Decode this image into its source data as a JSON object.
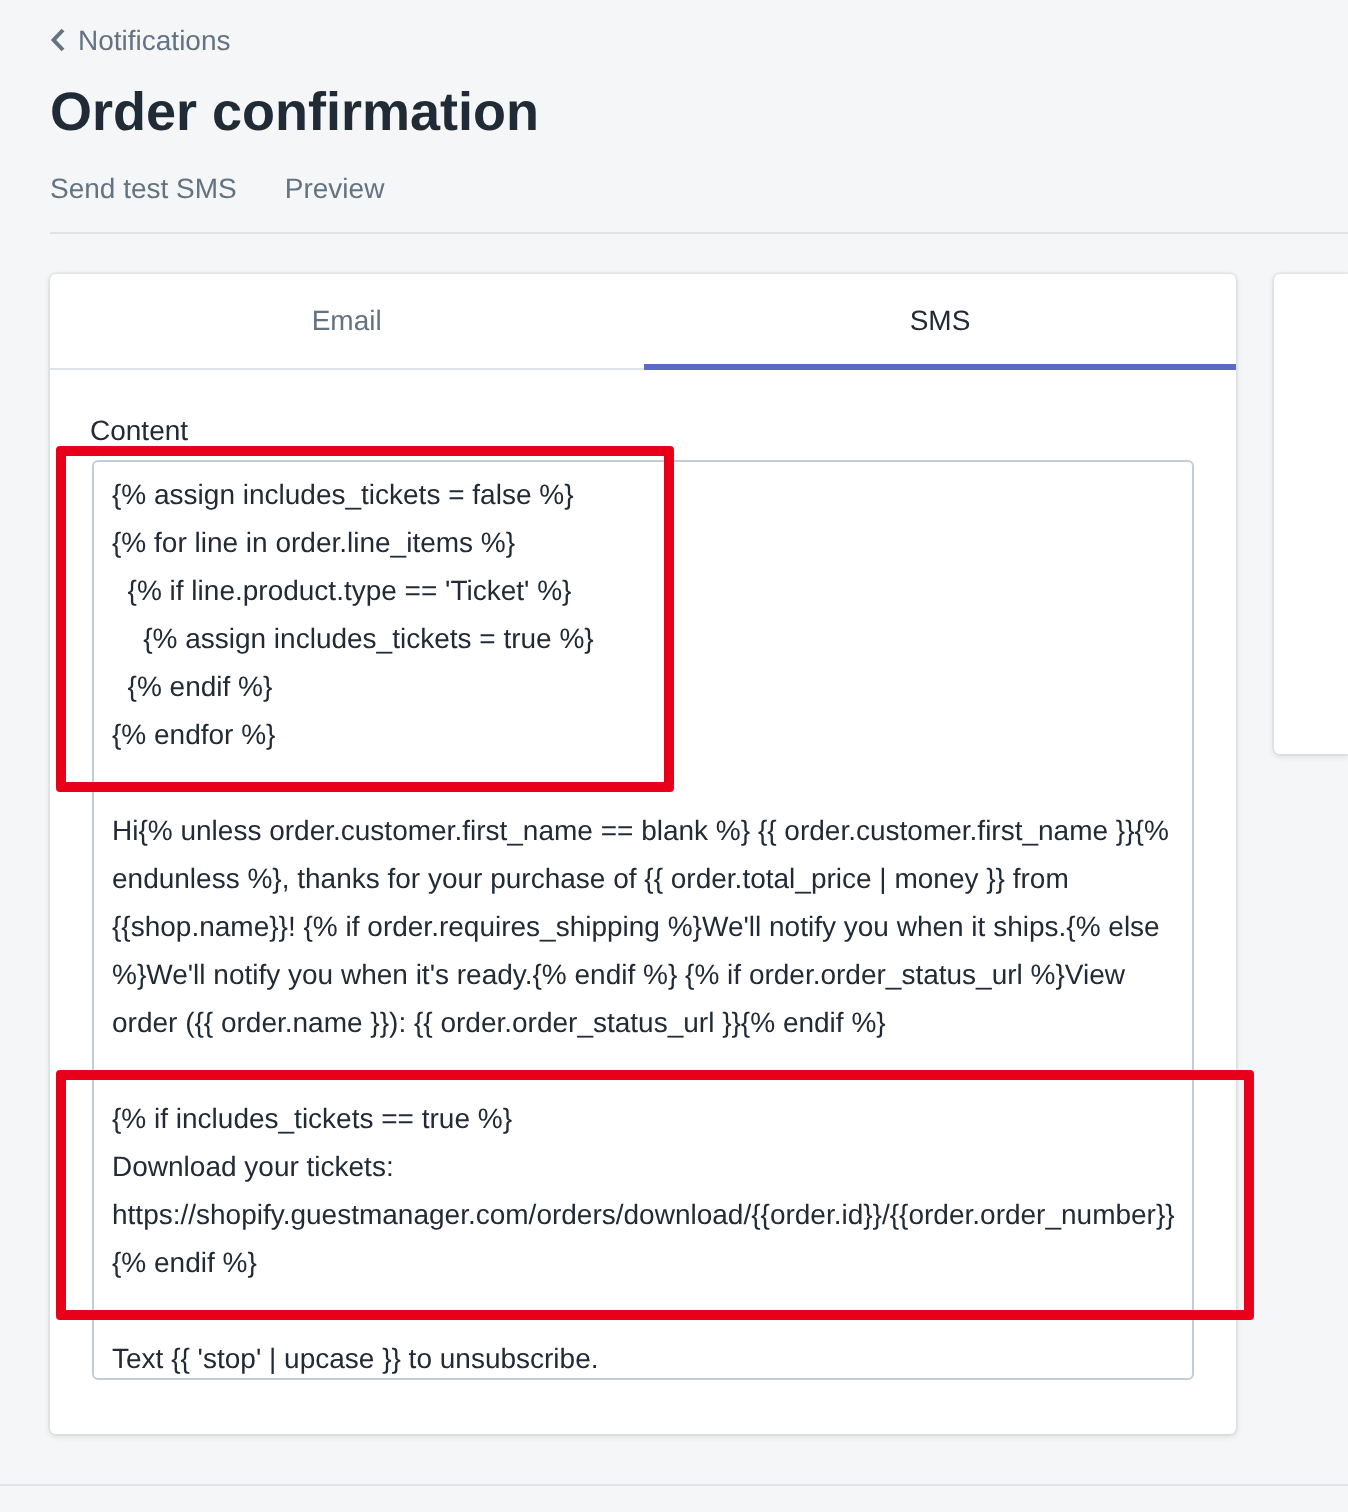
{
  "back_link": {
    "label": "Notifications"
  },
  "title": "Order confirmation",
  "actions": [
    "Send test SMS",
    "Preview"
  ],
  "tabs": [
    {
      "label": "Email",
      "selected": false
    },
    {
      "label": "SMS",
      "selected": true
    }
  ],
  "content": {
    "label": "Content",
    "blocks": [
      {
        "highlighted": true,
        "lines": [
          "{% assign includes_tickets = false %}",
          "{% for line in order.line_items %}",
          "  {% if line.product.type == 'Ticket' %}",
          "    {% assign includes_tickets = true %}",
          "  {% endif %}",
          "{% endfor %}"
        ]
      },
      {
        "highlighted": false,
        "lines": [
          "Hi{% unless order.customer.first_name == blank %} {{ order.customer.first_name }}{% endunless %}, thanks for your purchase of {{ order.total_price | money }} from {{shop.name}}! {% if order.requires_shipping %}We'll notify you when it ships.{% else %}We'll notify you when it's ready.{% endif %} {% if order.order_status_url %}View order ({{ order.name }}): {{ order.order_status_url }}{% endif %}"
        ]
      },
      {
        "highlighted": true,
        "lines": [
          "{% if includes_tickets == true %}",
          "Download your tickets:",
          "https://shopify.guestmanager.com/orders/download/{{order.id}}/{{order.order_number}}",
          "{% endif %}"
        ]
      },
      {
        "highlighted": false,
        "lines": [
          "Text {{ 'stop' | upcase }} to unsubscribe."
        ]
      }
    ]
  }
}
